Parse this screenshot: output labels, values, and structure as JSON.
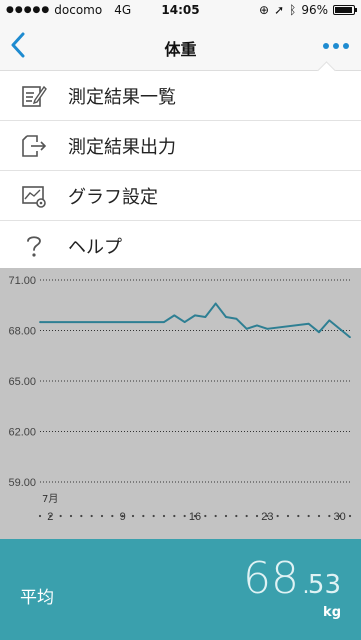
{
  "status_bar": {
    "carrier": "docomo",
    "network": "4G",
    "time": "14:05",
    "battery": "96%",
    "battery_level": 0.96
  },
  "nav": {
    "title": "体重"
  },
  "menu": {
    "items": [
      {
        "label": "測定結果一覧",
        "icon": "list-edit-icon"
      },
      {
        "label": "測定結果出力",
        "icon": "export-icon"
      },
      {
        "label": "グラフ設定",
        "icon": "chart-settings-icon"
      },
      {
        "label": "ヘルプ",
        "icon": "help-icon"
      }
    ]
  },
  "chart_data": {
    "type": "line",
    "y_ticks": [
      "71.00",
      "68.00",
      "65.00",
      "62.00",
      "59.00"
    ],
    "ylim": [
      59,
      71
    ],
    "month_label": "7月",
    "x_ticks": [
      "2",
      "9",
      "16",
      "23",
      "30"
    ],
    "xlim": [
      1,
      31
    ],
    "series": [
      {
        "color": "#2e7f93",
        "x": [
          1,
          13,
          14,
          15,
          16,
          17,
          18,
          19,
          20,
          21,
          22,
          23,
          27,
          28,
          29,
          31
        ],
        "y": [
          68.5,
          68.5,
          68.9,
          68.5,
          68.9,
          68.8,
          69.6,
          68.8,
          68.7,
          68.1,
          68.3,
          68.1,
          68.4,
          67.9,
          68.6,
          67.6
        ]
      }
    ],
    "grid": true
  },
  "summary": {
    "label": "平均",
    "value_int": "68.",
    "value_dec": "53",
    "unit": "kg"
  },
  "colors": {
    "accent": "#1e8bd0",
    "chart_bg": "#c3c3c3",
    "summary_bg": "#3aa0ad",
    "line": "#2e7f93"
  }
}
